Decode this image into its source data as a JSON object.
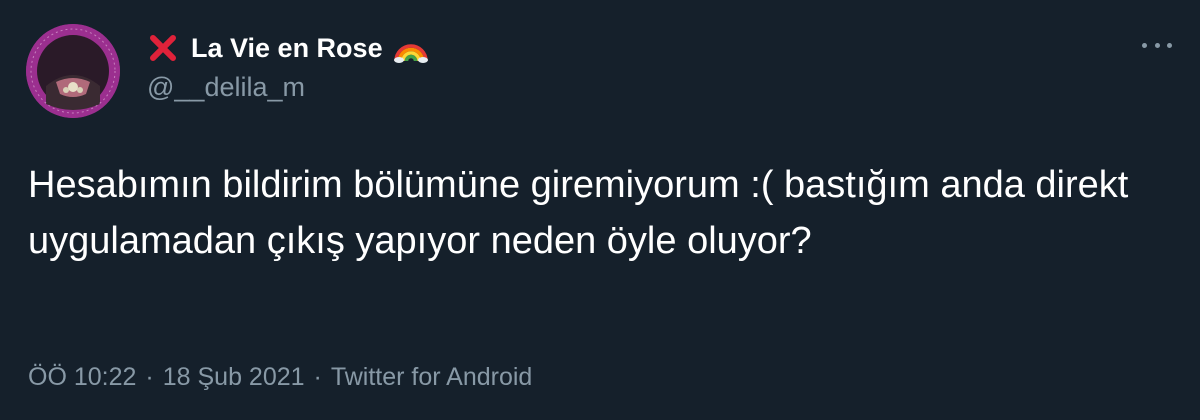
{
  "tweet": {
    "display_name": "La Vie en Rose",
    "handle": "@__delila_m",
    "text": "Hesabımın bildirim bölümüne giremiyorum :( bastığım anda direkt uygulamadan çıkış yapıyor neden öyle oluyor?",
    "time": "ÖÖ 10:22",
    "date": "18 Şub 2021",
    "separator": "·",
    "source": "Twitter for Android"
  },
  "icons": {
    "name_prefix": "red-x-mark-icon",
    "name_suffix": "rainbow-icon",
    "menu": "more-options-icon"
  },
  "colors": {
    "background": "#15202b",
    "text_primary": "#ffffff",
    "text_secondary": "#8899a6",
    "avatar_ring": "#9b2f8f",
    "x_mark": "#e0223a"
  }
}
